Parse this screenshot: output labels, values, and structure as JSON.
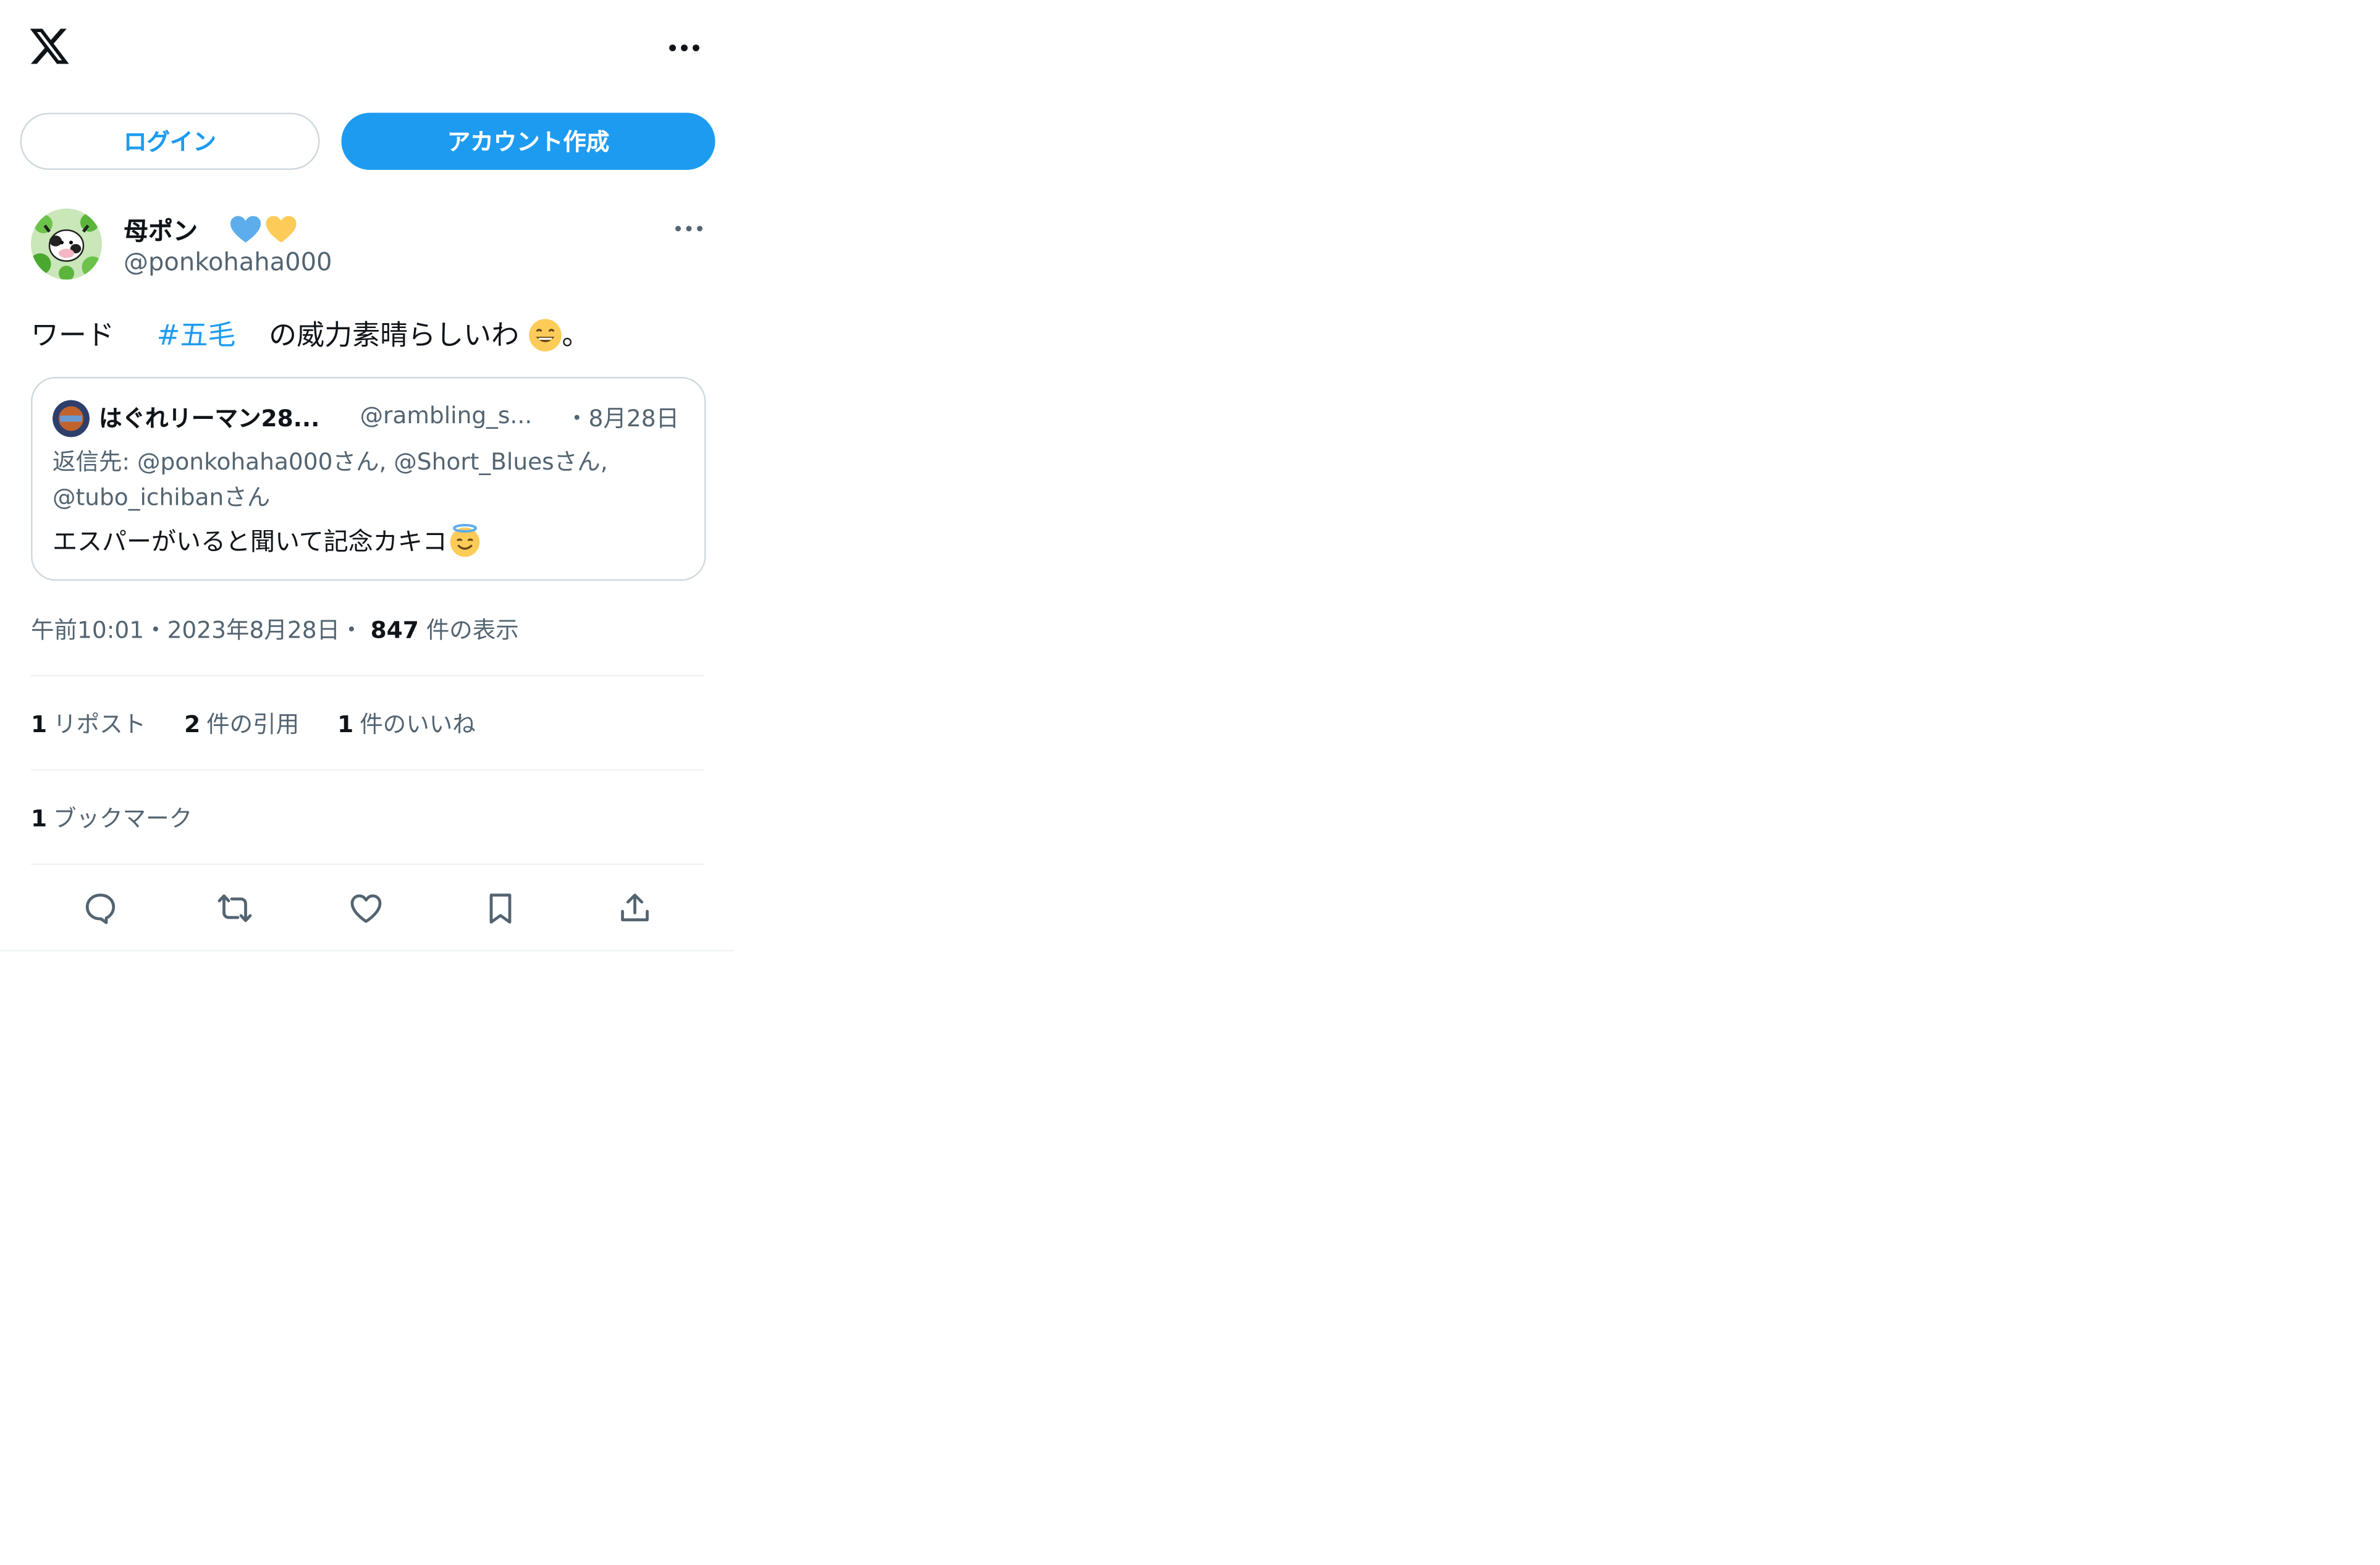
{
  "header": {
    "logo_icon": "x-logo-icon",
    "more_icon": "more-horizontal-icon"
  },
  "auth": {
    "login_label": "ログイン",
    "signup_label": "アカウント作成"
  },
  "post": {
    "author_name": "母ポン",
    "author_emoji": "blue-and-yellow-hearts",
    "author_handle": "@ponkohaha000",
    "text_prefix": "ワード",
    "hashtag": "#五毛",
    "text_suffix": "の威力素晴らしいわ",
    "text_end": "。",
    "inline_emoji": "grinning-face-emoji",
    "quote": {
      "author_name": "はぐれリーマン28...",
      "author_handle": "@rambling_s...",
      "date": "・8月28日",
      "reply_to": "返信先: @ponkohaha000さん, @Short_Bluesさん, @tubo_ichibanさん",
      "text": "エスパーがいると聞いて記念カキコ",
      "text_emoji": "smiling-face-with-halo-emoji"
    },
    "meta": {
      "time_date": "午前10:01・2023年8月28日・",
      "views_count": "847",
      "views_label": "件の表示"
    },
    "stats": {
      "reposts_count": "1",
      "reposts_label": "リポスト",
      "quotes_count": "2",
      "quotes_label": "件の引用",
      "likes_count": "1",
      "likes_label": "件のいいね",
      "bookmarks_count": "1",
      "bookmarks_label": "ブックマーク"
    },
    "actions": [
      "reply-icon",
      "repost-icon",
      "like-icon",
      "bookmark-icon",
      "share-icon"
    ]
  },
  "colors": {
    "accent": "#1d9bf0",
    "text_primary": "#0f1419",
    "text_secondary": "#536471",
    "border": "#cfd9de"
  }
}
